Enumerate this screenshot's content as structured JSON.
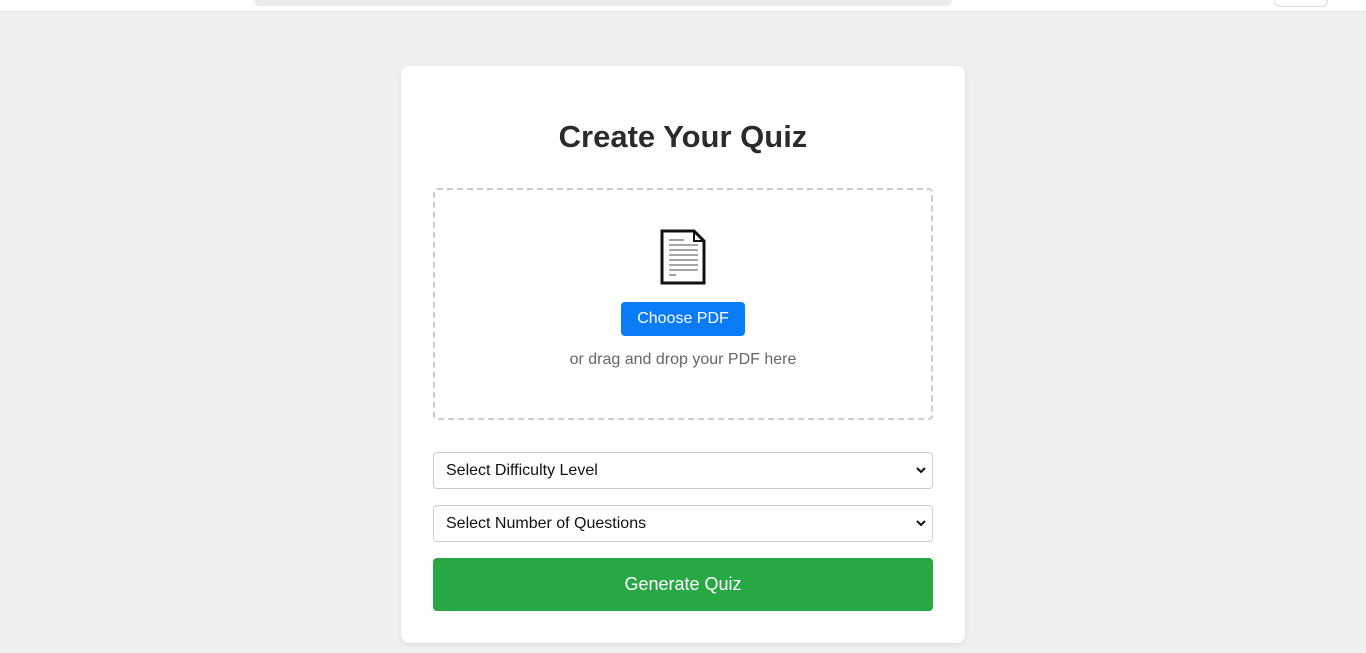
{
  "quiz_form": {
    "title": "Create Your Quiz",
    "upload": {
      "icon": "document-icon",
      "choose_button_label": "Choose PDF",
      "drop_hint": "or drag and drop your PDF here"
    },
    "difficulty_select": {
      "selected": "Select Difficulty Level"
    },
    "questions_select": {
      "selected": "Select Number of Questions"
    },
    "generate_button_label": "Generate Quiz"
  },
  "colors": {
    "page_background": "#f0f0f0",
    "card_background": "#ffffff",
    "choose_button": "#0a7cf5",
    "generate_button": "#28a745",
    "title_text": "#2b2b2b",
    "hint_text": "#666666"
  }
}
